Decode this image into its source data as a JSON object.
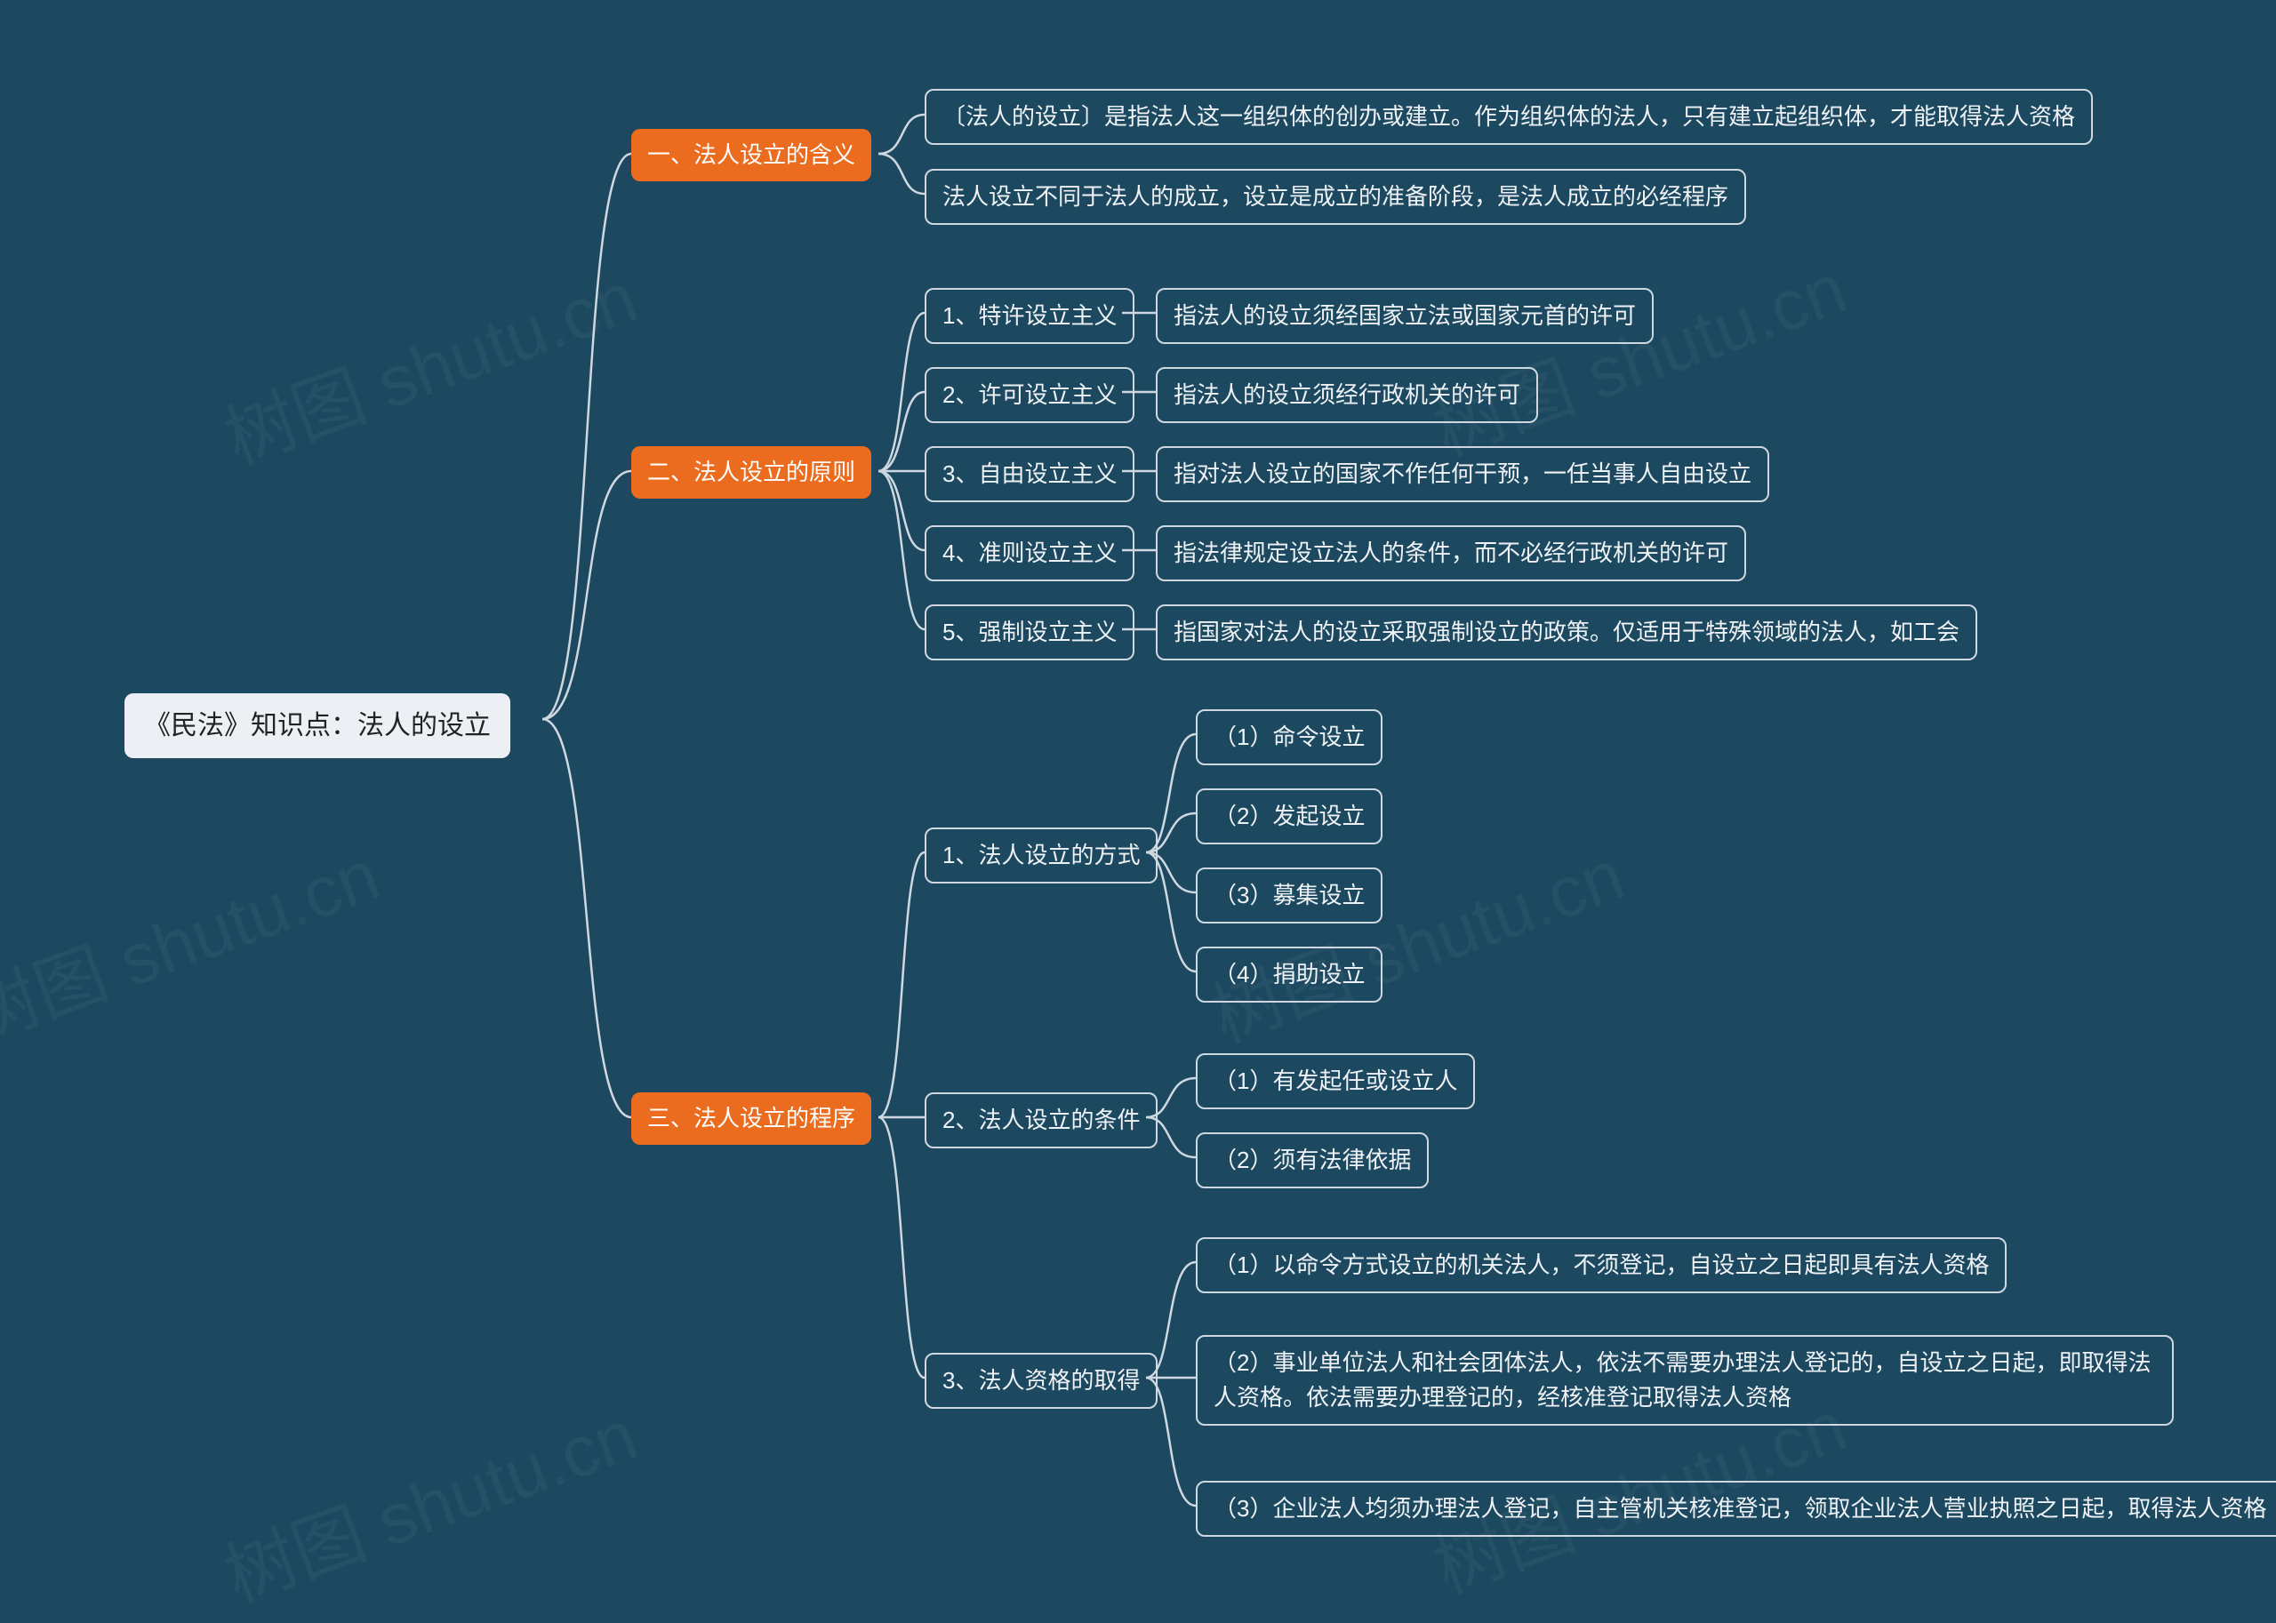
{
  "root": {
    "label": "《民法》知识点：法人的设立"
  },
  "b1": {
    "label": "一、法人设立的含义",
    "children": {
      "c1": "〔法人的设立〕是指法人这一组织体的创办或建立。作为组织体的法人，只有建立起组织体，才能取得法人资格",
      "c2": "法人设立不同于法人的成立，设立是成立的准备阶段，是法人成立的必经程序"
    }
  },
  "b2": {
    "label": "二、法人设立的原则",
    "children": {
      "c1": {
        "label": "1、特许设立主义",
        "desc": "指法人的设立须经国家立法或国家元首的许可"
      },
      "c2": {
        "label": "2、许可设立主义",
        "desc": "指法人的设立须经行政机关的许可"
      },
      "c3": {
        "label": "3、自由设立主义",
        "desc": "指对法人设立的国家不作任何干预，一任当事人自由设立"
      },
      "c4": {
        "label": "4、准则设立主义",
        "desc": "指法律规定设立法人的条件，而不必经行政机关的许可"
      },
      "c5": {
        "label": "5、强制设立主义",
        "desc": "指国家对法人的设立采取强制设立的政策。仅适用于特殊领域的法人，如工会"
      }
    }
  },
  "b3": {
    "label": "三、法人设立的程序",
    "children": {
      "c1": {
        "label": "1、法人设立的方式",
        "items": {
          "i1": "（1）命令设立",
          "i2": "（2）发起设立",
          "i3": "（3）募集设立",
          "i4": "（4）捐助设立"
        }
      },
      "c2": {
        "label": "2、法人设立的条件",
        "items": {
          "i1": "（1）有发起任或设立人",
          "i2": "（2）须有法律依据"
        }
      },
      "c3": {
        "label": "3、法人资格的取得",
        "items": {
          "i1": "（1）以命令方式设立的机关法人，不须登记，自设立之日起即具有法人资格",
          "i2": "（2）事业单位法人和社会团体法人，依法不需要办理法人登记的，自设立之日起，即取得法人资格。依法需要办理登记的，经核准登记取得法人资格",
          "i3": "（3）企业法人均须办理法人登记，自主管机关核准登记，领取企业法人营业执照之日起，取得法人资格"
        }
      }
    }
  },
  "watermarks": [
    "树图 shutu.cn",
    "树图 shutu.cn",
    "树图 shutu.cn",
    "树图 shutu.cn",
    "树图 shutu.cn",
    "树图 shutu.cn"
  ]
}
